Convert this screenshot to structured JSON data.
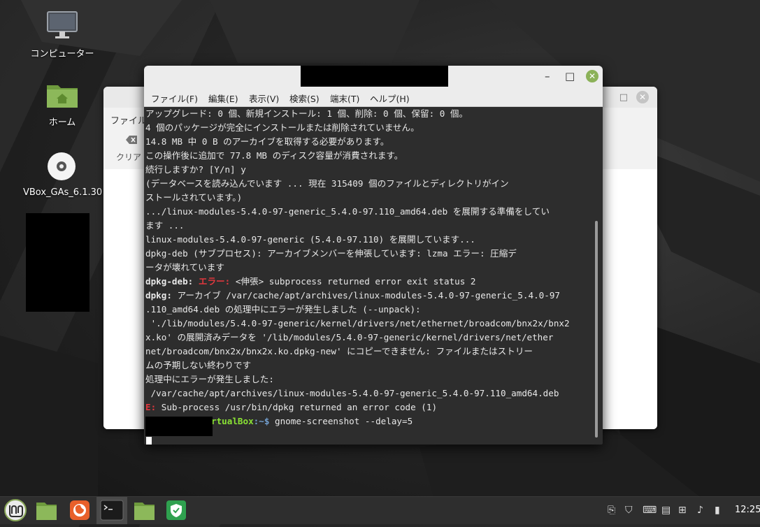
{
  "desktop": {
    "icons": [
      {
        "label": "コンピューター",
        "icon": "monitor-icon"
      },
      {
        "label": "ホーム",
        "icon": "home-folder-icon"
      },
      {
        "label": "VBox_GAs_6.1.30",
        "icon": "disc-icon"
      }
    ]
  },
  "background_window": {
    "menu_label": "ファイル",
    "clear_label": "クリア"
  },
  "terminal": {
    "menu": [
      "ファイル(F)",
      "編集(E)",
      "表示(V)",
      "検索(S)",
      "端末(T)",
      "ヘルプ(H)"
    ],
    "lines": [
      "アップグレード: 0 個、新規インストール: 1 個、削除: 0 個、保留: 0 個。",
      "4 個のパッケージが完全にインストールまたは削除されていません。",
      "14.8 MB 中 0 B のアーカイブを取得する必要があります。",
      "この操作後に追加で 77.8 MB のディスク容量が消費されます。",
      "続行しますか? [Y/n] y",
      "(データベースを読み込んでいます ... 現在 315409 個のファイルとディレクトリがイン",
      "ストールされています。)",
      ".../linux-modules-5.4.0-97-generic_5.4.0-97.110_amd64.deb を展開する準備をしてい",
      "ます ...",
      "linux-modules-5.4.0-97-generic (5.4.0-97.110) を展開しています...",
      "dpkg-deb (サブプロセス): アーカイブメンバーを伸張しています: lzma エラー: 圧縮デ",
      "ータが壊れています"
    ],
    "dpkg_deb_line": {
      "prefix": "dpkg-deb:",
      "error": "エラー:",
      "rest": "<伸張> subprocess returned error exit status 2"
    },
    "dpkg_line": {
      "prefix": "dpkg:",
      "rest": "アーカイブ /var/cache/apt/archives/linux-modules-5.4.0-97-generic_5.4.0-97"
    },
    "lines2": [
      ".110_amd64.deb の処理中にエラーが発生しました (--unpack):",
      " './lib/modules/5.4.0-97-generic/kernel/drivers/net/ethernet/broadcom/bnx2x/bnx2",
      "x.ko' の展開済みデータを '/lib/modules/5.4.0-97-generic/kernel/drivers/net/ether",
      "net/broadcom/bnx2x/bnx2x.ko.dpkg-new' にコピーできません: ファイルまたはストリー",
      "ムの予期しない終わりです",
      "処理中にエラーが発生しました:",
      " /var/cache/apt/archives/linux-modules-5.4.0-97-generic_5.4.0-97.110_amd64.deb"
    ],
    "e_line": {
      "prefix": "E:",
      "rest": "Sub-process /usr/bin/dpkg returned an error code (1)"
    },
    "prompt": {
      "host_tail": "rtualBox",
      "sep": ":~$",
      "command": "gnome-screenshot --delay=5"
    }
  },
  "taskbar": {
    "clock": "12:25",
    "items": [
      "mint-menu-icon",
      "files-icon",
      "firefox-icon",
      "terminal-icon",
      "folder-icon",
      "shield-icon"
    ],
    "tray": [
      "clipboard-icon",
      "shield-tray-icon",
      "keyboard-icon",
      "document-icon",
      "network-icon",
      "speaker-icon",
      "battery-icon"
    ]
  }
}
